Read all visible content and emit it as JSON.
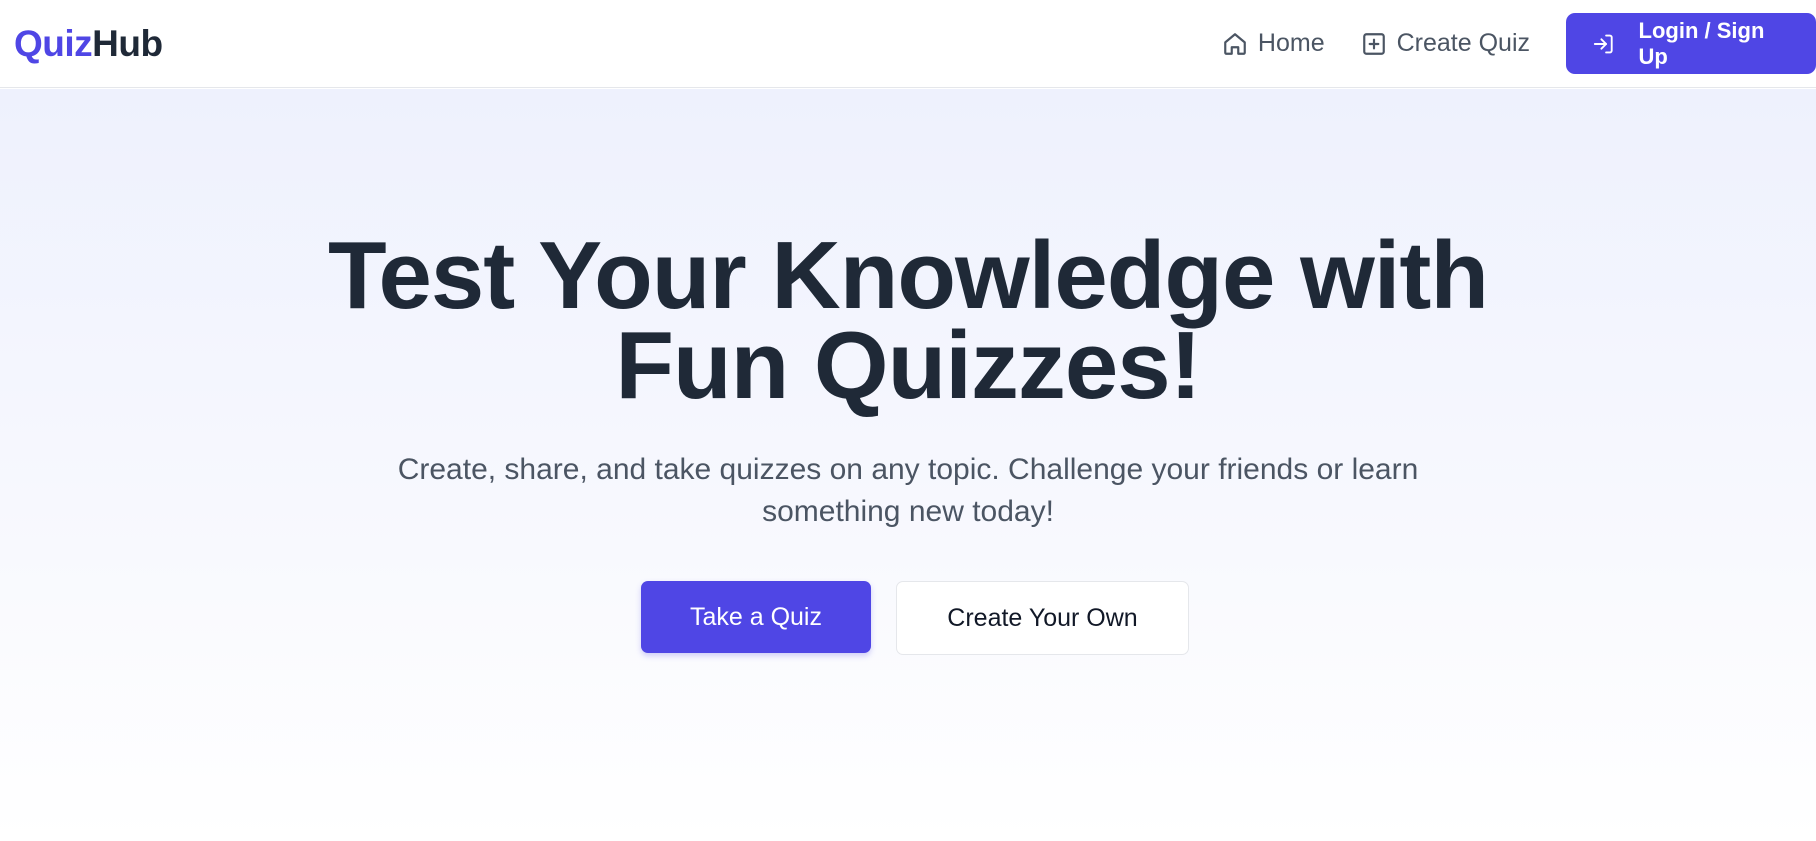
{
  "brand": {
    "name_accent": "Quiz",
    "name_rest": "Hub",
    "accent_color": "#4f46e5"
  },
  "nav": {
    "home": {
      "label": "Home",
      "icon": "home-icon"
    },
    "create_quiz": {
      "label": "Create Quiz",
      "icon": "plus-square-icon"
    },
    "login": {
      "label": "Login / Sign Up",
      "icon": "login-icon"
    }
  },
  "hero": {
    "title": "Test Your Knowledge with Fun Quizzes!",
    "subtitle": "Create, share, and take quizzes on any topic. Challenge your friends or learn something new today!",
    "primary_button": "Take a Quiz",
    "secondary_button": "Create Your Own"
  }
}
